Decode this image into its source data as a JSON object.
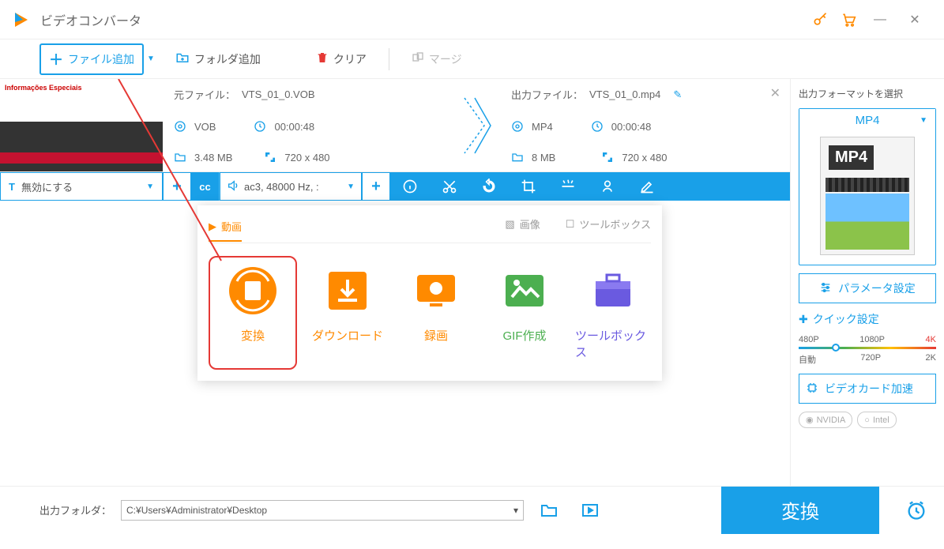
{
  "app": {
    "title": "ビデオコンバータ"
  },
  "toolbar": {
    "add_file": "ファイル追加",
    "add_folder": "フォルダ追加",
    "clear": "クリア",
    "merge": "マージ"
  },
  "item": {
    "thumb_title": "Informações Especiais",
    "source": {
      "label": "元ファイル：",
      "name": "VTS_01_0.VOB",
      "format": "VOB",
      "duration": "00:00:48",
      "size": "3.48 MB",
      "dimensions": "720 x 480"
    },
    "output": {
      "label": "出力ファイル：",
      "name": "VTS_01_0.mp4",
      "format": "MP4",
      "duration": "00:00:48",
      "size": "8 MB",
      "dimensions": "720 x 480"
    }
  },
  "editbar": {
    "subtitle": "無効にする",
    "cc": "cc",
    "audio": "ac3, 48000 Hz, :"
  },
  "features": {
    "tabs": {
      "video": "動画",
      "image": "画像",
      "toolbox": "ツールボックス"
    },
    "cards": {
      "convert": "変換",
      "download": "ダウンロード",
      "record": "録画",
      "gif": "GIF作成",
      "toolbox": "ツールボックス"
    }
  },
  "sidebar": {
    "format_label": "出力フォーマットを選択",
    "format": "MP4",
    "mp4_tag": "MP4",
    "param_btn": "パラメータ設定",
    "quick_label": "クイック設定",
    "res": {
      "r480": "480P",
      "r1080": "1080P",
      "r4k": "4K",
      "auto": "自動",
      "r720": "720P",
      "r2k": "2K"
    },
    "gpu_btn": "ビデオカード加速",
    "nvidia": "NVIDIA",
    "intel": "Intel"
  },
  "footer": {
    "label": "出力フォルダ：",
    "path": "C:¥Users¥Administrator¥Desktop",
    "convert": "変換"
  }
}
